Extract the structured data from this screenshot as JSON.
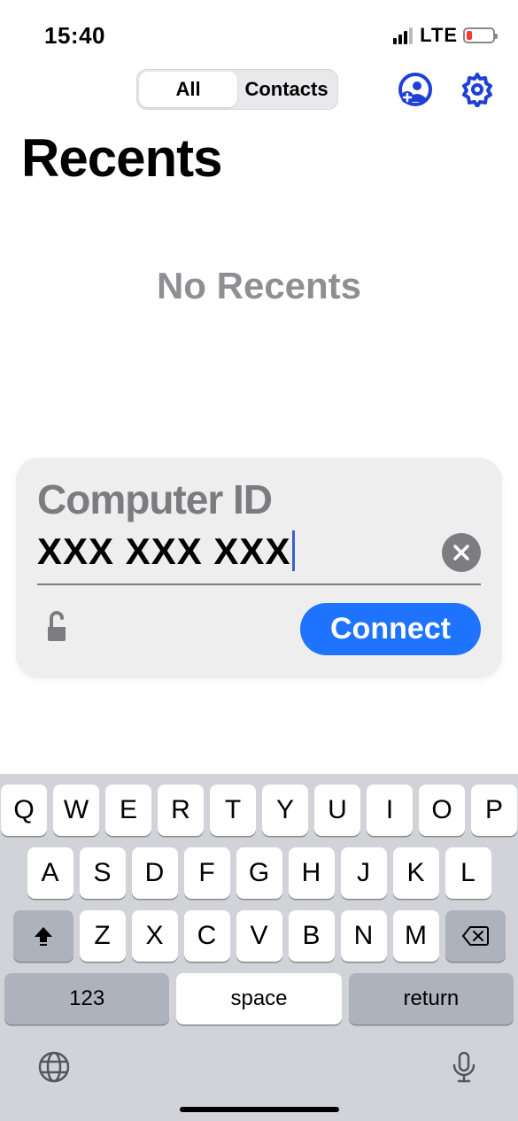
{
  "status": {
    "time": "15:40",
    "network": "LTE"
  },
  "header": {
    "segments": {
      "all": "All",
      "contacts": "Contacts"
    }
  },
  "page": {
    "title": "Recents",
    "empty_label": "No Recents"
  },
  "card": {
    "title": "Computer ID",
    "input_value": "XXX XXX XXX",
    "connect_label": "Connect"
  },
  "keyboard": {
    "row1": [
      "Q",
      "W",
      "E",
      "R",
      "T",
      "Y",
      "U",
      "I",
      "O",
      "P"
    ],
    "row2": [
      "A",
      "S",
      "D",
      "F",
      "G",
      "H",
      "J",
      "K",
      "L"
    ],
    "row3": [
      "Z",
      "X",
      "C",
      "V",
      "B",
      "N",
      "M"
    ],
    "numbers_label": "123",
    "space_label": "space",
    "return_label": "return"
  }
}
